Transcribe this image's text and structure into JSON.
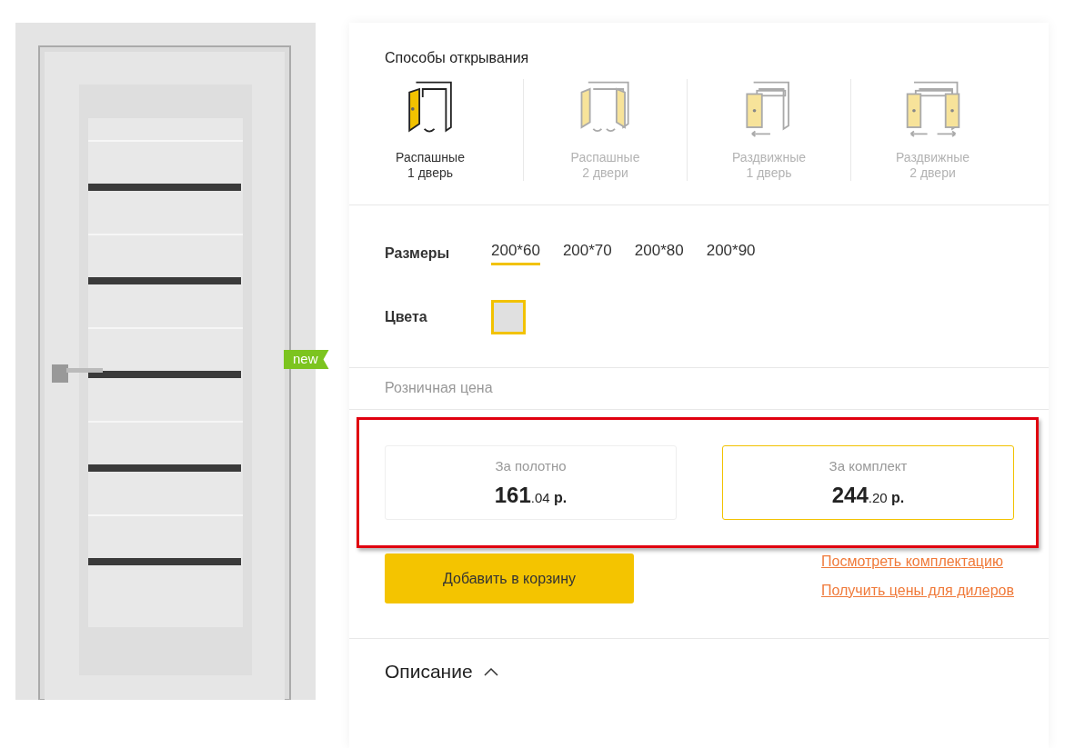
{
  "product_image": {
    "badge": "new"
  },
  "opening": {
    "title": "Способы открывания",
    "methods": [
      {
        "kind": "swing1",
        "line1": "Распашные",
        "line2": "1 дверь",
        "selected": true
      },
      {
        "kind": "swing2",
        "line1": "Распашные",
        "line2": "2 двери",
        "selected": false
      },
      {
        "kind": "slide1",
        "line1": "Раздвижные",
        "line2": "1 дверь",
        "selected": false
      },
      {
        "kind": "slide2",
        "line1": "Раздвижные",
        "line2": "2 двери",
        "selected": false
      }
    ]
  },
  "sizes": {
    "label": "Размеры",
    "options": [
      {
        "label": "200*60",
        "selected": true
      },
      {
        "label": "200*70",
        "selected": false
      },
      {
        "label": "200*80",
        "selected": false
      },
      {
        "label": "200*90",
        "selected": false
      }
    ]
  },
  "colors": {
    "label": "Цвета",
    "swatches": [
      {
        "color": "#e0e0e0",
        "selected": true
      }
    ]
  },
  "retail_label": "Розничная цена",
  "prices": [
    {
      "label": "За полотно",
      "whole": "161",
      "cents": ".04",
      "currency": "р.",
      "selected": false
    },
    {
      "label": "За комплект",
      "whole": "244",
      "cents": ".20",
      "currency": "р.",
      "selected": true
    }
  ],
  "add_to_cart": "Добавить в корзину",
  "links": [
    "Посмотреть комплектацию",
    "Получить цены для дилеров"
  ],
  "description": {
    "title": "Описание",
    "expanded": true
  }
}
